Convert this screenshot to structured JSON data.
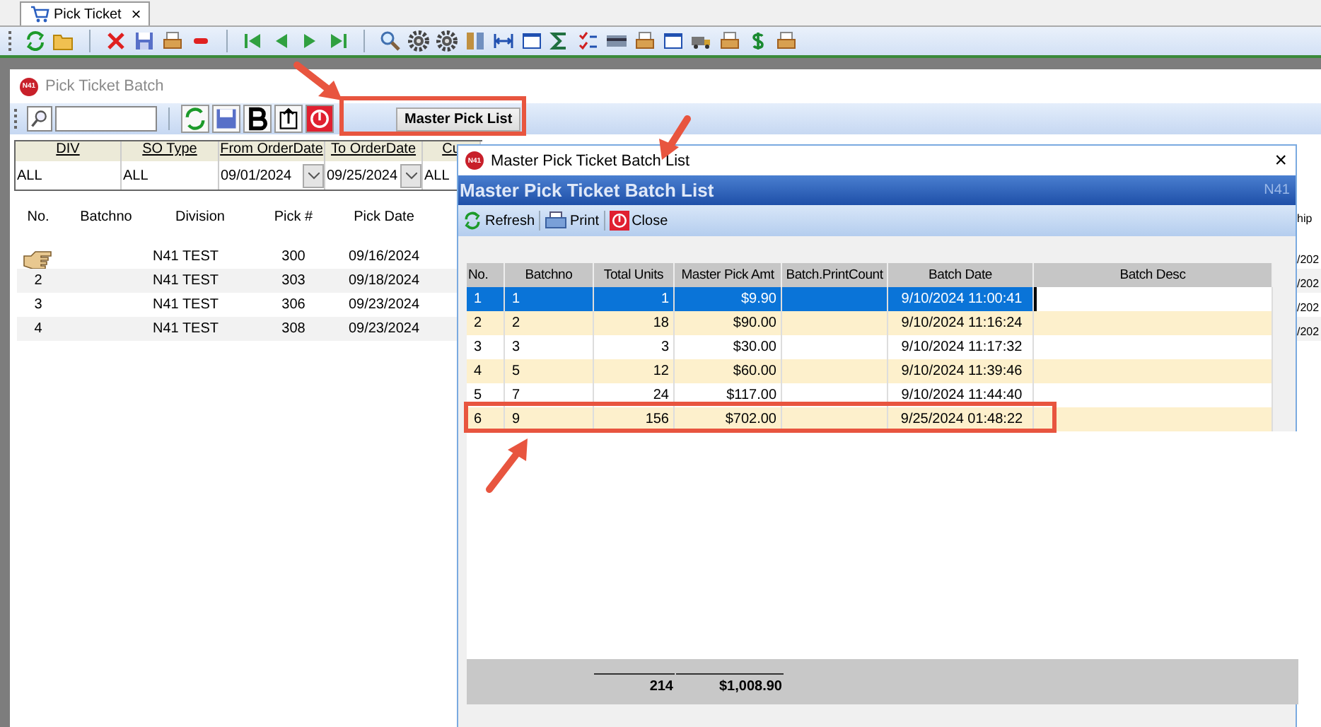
{
  "tab": {
    "label": "Pick Ticket",
    "close": "×"
  },
  "panel": {
    "logo": "N41",
    "title": "Pick Ticket Batch",
    "master_button": "Master Pick List"
  },
  "filter": {
    "columns": [
      {
        "label": "DIV",
        "value": "ALL",
        "kind": "text"
      },
      {
        "label": "SO Type",
        "value": "ALL",
        "kind": "text"
      },
      {
        "label": "From OrderDate",
        "value": "09/01/2024",
        "kind": "date"
      },
      {
        "label": "To OrderDate",
        "value": "09/25/2024",
        "kind": "date"
      },
      {
        "label": "Cu",
        "value": "ALL",
        "kind": "text"
      }
    ]
  },
  "grid": {
    "columns": [
      "No.",
      "Batchno",
      "Division",
      "Pick #",
      "Pick Date"
    ],
    "rows": [
      {
        "current": true,
        "division": "N41 TEST",
        "pick": "300",
        "date": "09/16/2024"
      },
      {
        "current": false,
        "no": "2",
        "division": "N41 TEST",
        "pick": "303",
        "date": "09/18/2024"
      },
      {
        "current": false,
        "no": "3",
        "division": "N41 TEST",
        "pick": "306",
        "date": "09/23/2024"
      },
      {
        "current": false,
        "no": "4",
        "division": "N41 TEST",
        "pick": "308",
        "date": "09/23/2024"
      }
    ],
    "column_6": {
      "header": "hip",
      "cells": [
        "/202",
        "/202",
        "/202",
        "/202"
      ]
    }
  },
  "dialog": {
    "logo": "N41",
    "title": "Master Pick Ticket Batch List",
    "close": "×",
    "heading": "Master Pick Ticket Batch List",
    "brand": "N41",
    "toolbar": [
      {
        "label": "Refresh",
        "kind": "refresh"
      },
      {
        "label": "Print",
        "kind": "print"
      },
      {
        "label": "Close",
        "kind": "close"
      }
    ],
    "columns": [
      "No.",
      "Batchno",
      "Total Units",
      "Master Pick Amt",
      "Batch.PrintCount",
      "Batch Date",
      "Batch Desc"
    ],
    "rows": [
      {
        "selected": true,
        "no": "1",
        "batchno": "1",
        "units": "1",
        "amount": "$9.90",
        "date": "9/10/2024 11:00:41"
      },
      {
        "selected": false,
        "no": "2",
        "batchno": "2",
        "units": "18",
        "amount": "$90.00",
        "date": "9/10/2024 11:16:24"
      },
      {
        "selected": false,
        "no": "3",
        "batchno": "3",
        "units": "3",
        "amount": "$30.00",
        "date": "9/10/2024 11:17:32"
      },
      {
        "selected": false,
        "no": "4",
        "batchno": "5",
        "units": "12",
        "amount": "$60.00",
        "date": "9/10/2024 11:39:46"
      },
      {
        "selected": false,
        "no": "5",
        "batchno": "7",
        "units": "24",
        "amount": "$117.00",
        "date": "9/10/2024 11:44:40"
      },
      {
        "selected": false,
        "no": "6",
        "batchno": "9",
        "units": "156",
        "amount": "$702.00",
        "date": "9/25/2024 01:48:22"
      }
    ],
    "totals": {
      "units": "214",
      "amount": "$1,008.90"
    }
  }
}
